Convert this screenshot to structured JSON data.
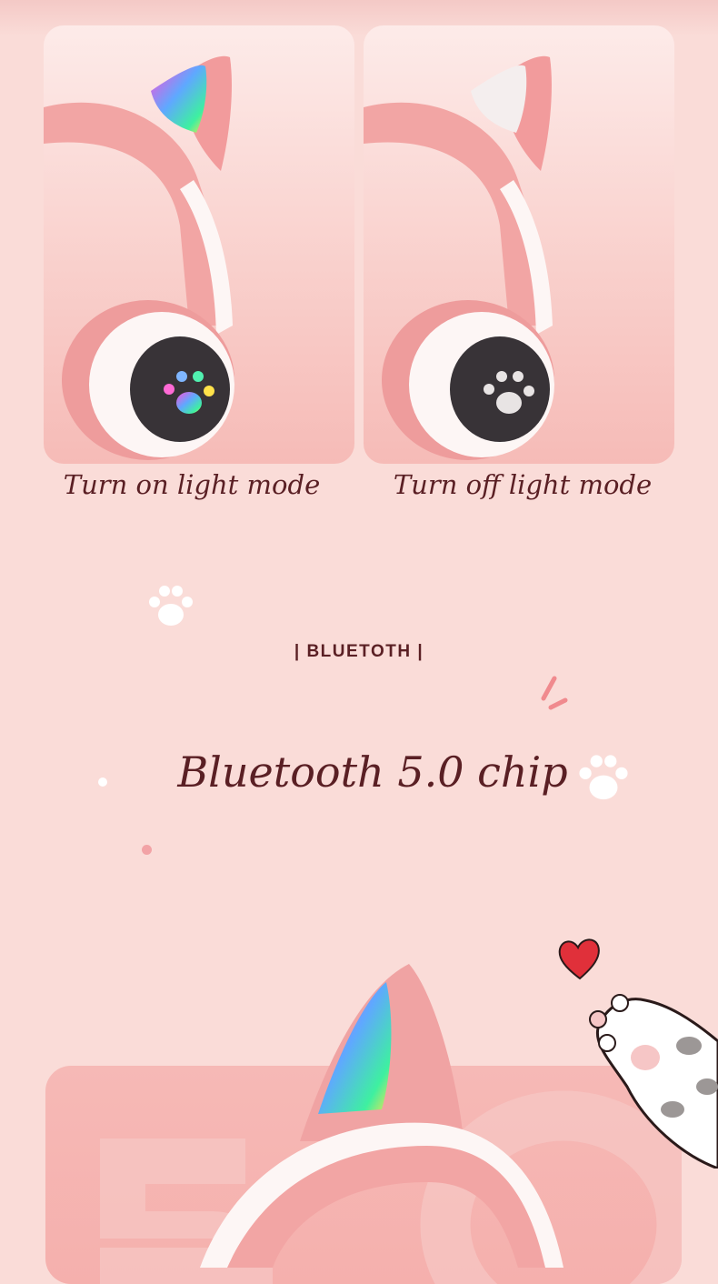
{
  "modes": {
    "on_label": "Turn on light mode",
    "off_label": "Turn off light mode"
  },
  "section": {
    "label": "| BLUETOTH |"
  },
  "headline": {
    "text": "Bluetooth 5.0 chip"
  },
  "icons": {
    "decor": [
      "paw-icon",
      "heart-icon",
      "cat-paw-illustration"
    ],
    "product": "cat-ear-headphone-illustration"
  },
  "colors": {
    "background": "#fadcd8",
    "text": "#5a1f24",
    "headphone_pink": "#f0a3a3",
    "headphone_white": "#fdf6f5",
    "heart": "#e0303a"
  }
}
